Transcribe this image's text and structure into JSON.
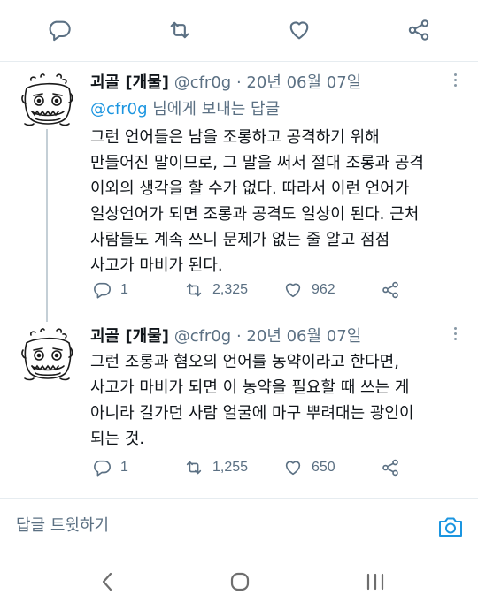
{
  "top_actions": {
    "icons": [
      "reply-icon",
      "retweet-icon",
      "like-icon",
      "share-icon"
    ]
  },
  "tweets": [
    {
      "name": "괴골 [개물]",
      "handle": "@cfr0g",
      "sep": "·",
      "date": "20년 06월 07일",
      "reply_prefix_mention": "@cfr0g",
      "reply_suffix": " 님에게 보내는 답글",
      "lines": [
        "그런 언어들은 남을 조롱하고 공격하기 위해",
        "만들어진 말이므로, 그 말을 써서 절대 조롱과 공격",
        "이외의 생각을 할 수가 없다. 따라서 이런 언어가",
        "일상언어가 되면 조롱과 공격도 일상이 된다. 근처",
        "사람들도 계속 쓰니 문제가 없는 줄 알고 점점",
        "사고가 마비가 된다."
      ],
      "replies": "1",
      "retweets": "2,325",
      "likes": "962"
    },
    {
      "name": "괴골 [개물]",
      "handle": "@cfr0g",
      "sep": "·",
      "date": "20년 06월 07일",
      "lines": [
        "그런 조롱과 혐오의 언어를 농약이라고 한다면,",
        "사고가 마비가 되면 이 농약을 필요할 때 쓰는 게",
        "아니라 길가던 사람 얼굴에 마구 뿌려대는 광인이",
        "되는 것."
      ],
      "replies": "1",
      "retweets": "1,255",
      "likes": "650"
    }
  ],
  "composer": {
    "placeholder": "답글 트윗하기"
  },
  "colors": {
    "text": "#0f1419",
    "secondary": "#5b7083",
    "accent": "#1b95e0",
    "divider": "#e6ecf0"
  }
}
